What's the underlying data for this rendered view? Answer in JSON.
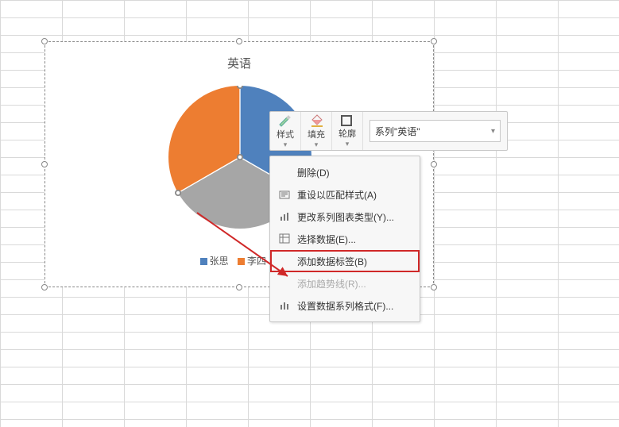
{
  "chart_data": {
    "type": "pie",
    "title": "英语",
    "series": [
      {
        "name": "张思",
        "value": 33,
        "color": "#4f81bd"
      },
      {
        "name": "李四",
        "value": 33,
        "color": "#ed7d31"
      },
      {
        "name": "",
        "value": 34,
        "color": "#a6a6a6"
      }
    ],
    "legend_items": [
      "张思",
      "李四"
    ]
  },
  "legend": {
    "item1": "张思",
    "item2": "李四"
  },
  "mini_toolbar": {
    "style_label": "样式",
    "fill_label": "填充",
    "outline_label": "轮廓",
    "series_selected": "系列\"英语\""
  },
  "context_menu": {
    "delete": "删除(D)",
    "reset_style": "重设以匹配样式(A)",
    "change_chart_type": "更改系列图表类型(Y)...",
    "select_data": "选择数据(E)...",
    "add_labels": "添加数据标签(B)",
    "add_trendline": "添加趋势线(R)...",
    "format_series": "设置数据系列格式(F)..."
  }
}
